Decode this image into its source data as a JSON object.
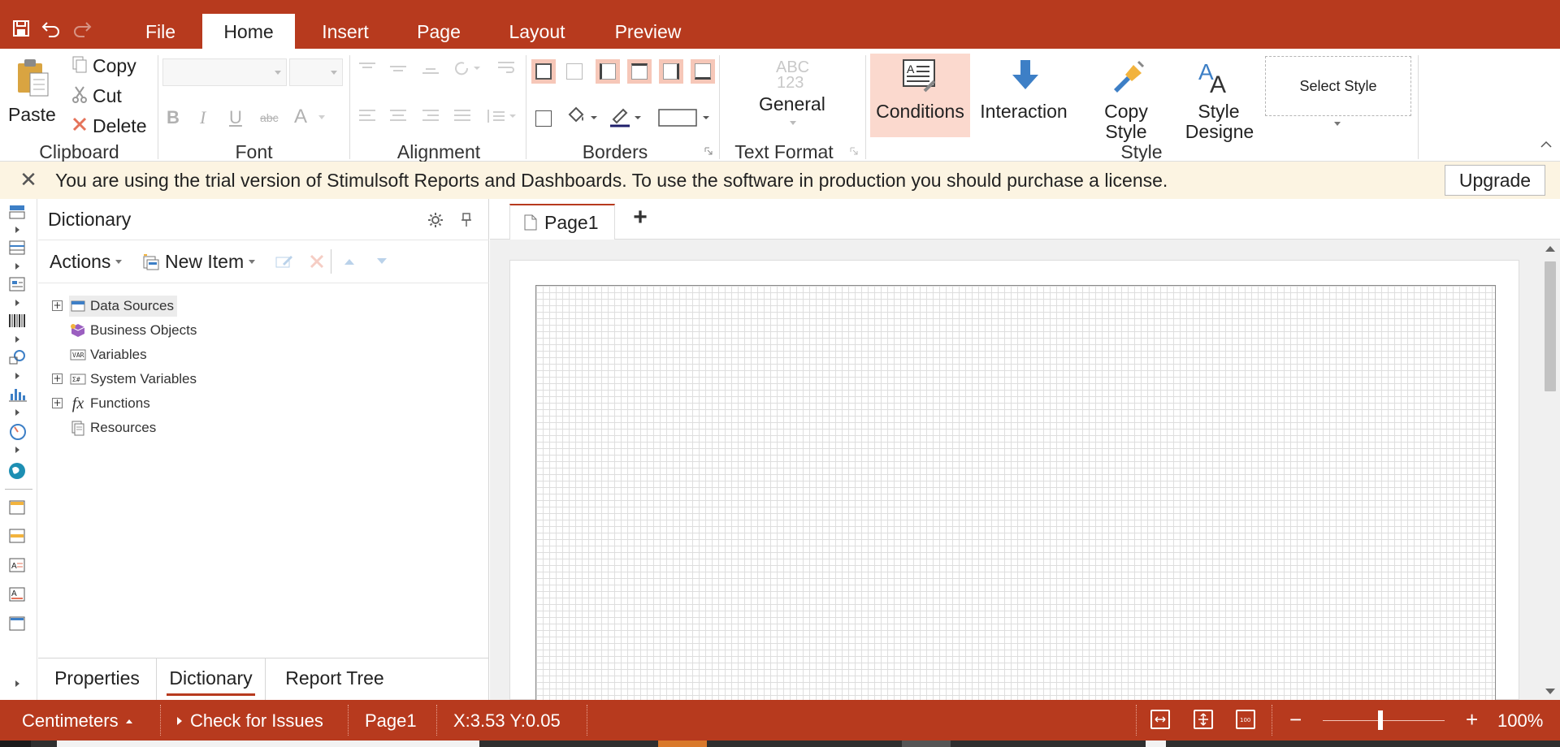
{
  "colors": {
    "accent": "#b73a1e",
    "notice_bg": "#fcf4e2",
    "highlight": "#fbd9ce"
  },
  "quick_access": [
    "save-icon",
    "undo-icon",
    "redo-icon"
  ],
  "tabs": [
    {
      "label": "File"
    },
    {
      "label": "Home",
      "active": true
    },
    {
      "label": "Insert"
    },
    {
      "label": "Page"
    },
    {
      "label": "Layout"
    },
    {
      "label": "Preview"
    }
  ],
  "ribbon": {
    "clipboard": {
      "group": "Clipboard",
      "paste": "Paste",
      "copy": "Copy",
      "cut": "Cut",
      "delete": "Delete"
    },
    "font": {
      "group": "Font",
      "bold": "B",
      "italic": "I",
      "underline": "U",
      "strike": "abc",
      "color": "A"
    },
    "alignment": {
      "group": "Alignment"
    },
    "borders": {
      "group": "Borders"
    },
    "text_format": {
      "group": "Text Format",
      "abc": "ABC",
      "num": "123",
      "format": "General"
    },
    "styles": {
      "conditions": "Conditions",
      "interaction": "Interaction",
      "copy_style_1": "Copy",
      "copy_style_2": "Style",
      "style_group": "Style",
      "style_designer_1": "Style",
      "style_designer_2": "Designe",
      "select_style": "Select Style"
    }
  },
  "notice": {
    "text": "You are using the trial version of Stimulsoft Reports and Dashboards. To use the software in production you should purchase a license.",
    "upgrade": "Upgrade"
  },
  "dictionary": {
    "title": "Dictionary",
    "actions": "Actions",
    "new_item": "New Item",
    "tree": [
      {
        "label": "Data Sources",
        "icon": "data-sources-icon",
        "expandable": true,
        "selected": true
      },
      {
        "label": "Business Objects",
        "icon": "business-objects-icon",
        "expandable": false
      },
      {
        "label": "Variables",
        "icon": "variables-icon",
        "expandable": false
      },
      {
        "label": "System Variables",
        "icon": "system-variables-icon",
        "expandable": true
      },
      {
        "label": "Functions",
        "icon": "functions-icon",
        "expandable": true
      },
      {
        "label": "Resources",
        "icon": "resources-icon",
        "expandable": false
      }
    ],
    "bottom_tabs": [
      "Properties",
      "Dictionary",
      "Report Tree"
    ],
    "active_bottom_tab": "Dictionary"
  },
  "page_tabs": [
    {
      "label": "Page1"
    }
  ],
  "status": {
    "units": "Centimeters",
    "check": "Check for Issues",
    "page": "Page1",
    "coords": "X:3.53 Y:0.05",
    "zoom": "100%",
    "zoom_level": 1.0
  }
}
